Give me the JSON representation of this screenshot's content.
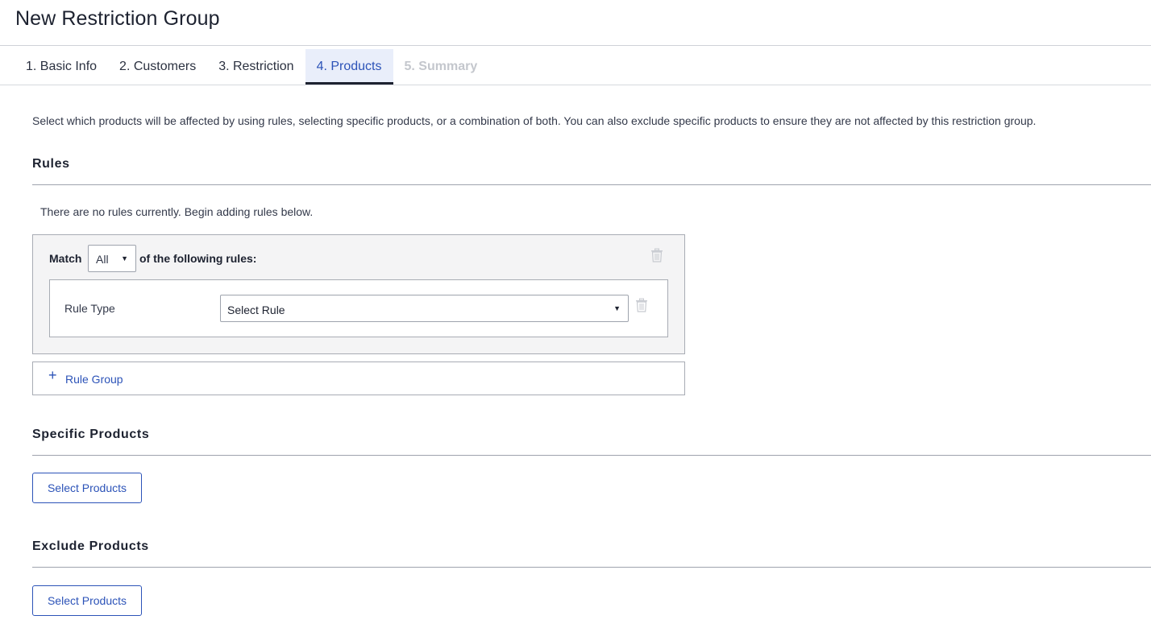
{
  "page": {
    "title": "New Restriction Group"
  },
  "tabs": [
    {
      "label": "1. Basic Info",
      "state": "default"
    },
    {
      "label": "2. Customers",
      "state": "default"
    },
    {
      "label": "3. Restriction",
      "state": "default"
    },
    {
      "label": "4. Products",
      "state": "active"
    },
    {
      "label": "5. Summary",
      "state": "disabled"
    }
  ],
  "intro": "Select which products will be affected by using rules, selecting specific products, or a combination of both. You can also exclude specific products to ensure they are not affected by this restriction group.",
  "rules": {
    "heading": "Rules",
    "empty_note": "There are no rules currently. Begin adding rules below.",
    "match_prefix": "Match",
    "match_value": "All",
    "match_suffix": "of the following rules:",
    "rule_type_label": "Rule Type",
    "rule_select_value": "Select Rule",
    "add_group_label": "Rule Group",
    "add_group_icon": "plus-icon",
    "delete_icon": "trash-icon"
  },
  "specific_products": {
    "heading": "Specific Products",
    "button_label": "Select Products"
  },
  "exclude_products": {
    "heading": "Exclude Products",
    "button_label": "Select Products"
  },
  "colors": {
    "accent": "#2c53b8",
    "active_tab_bg": "#e9eefa",
    "disabled_text": "#c4c7cd",
    "panel_bg": "#f4f4f5"
  }
}
